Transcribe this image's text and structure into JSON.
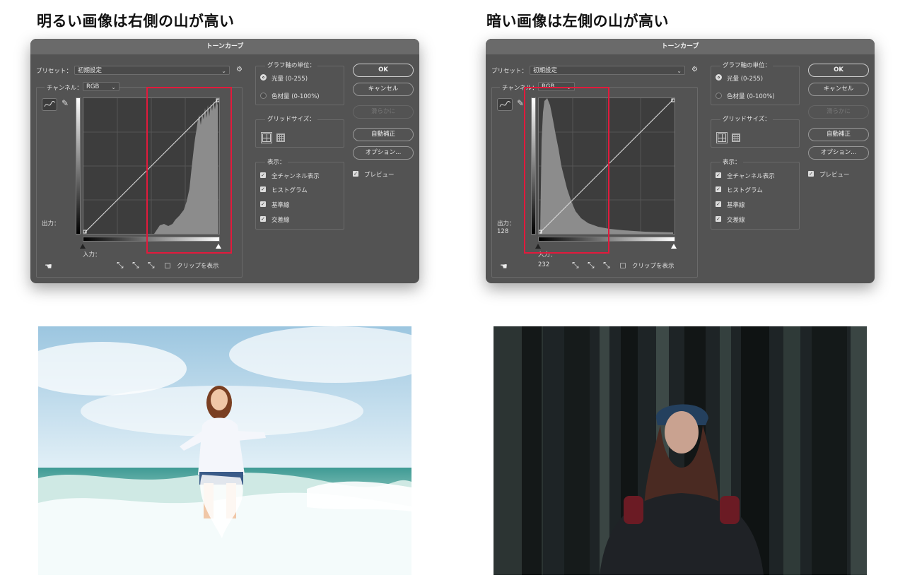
{
  "headings": {
    "bright": "明るい画像は右側の山が高い",
    "dark": "暗い画像は左側の山が高い"
  },
  "dialog": {
    "title": "トーンカーブ",
    "preset_label": "プリセット：",
    "preset_value": "初期設定",
    "channel_label": "チャンネル：",
    "channel_value": "RGB",
    "output_label": "出力：",
    "input_label": "入力：",
    "clip_label": "クリップを表示",
    "graph_unit_title": "グラフ軸の単位：",
    "radio_light": "光量 (0-255)",
    "radio_pigment": "色材量 (0-100%)",
    "grid_size_title": "グリッドサイズ：",
    "display_title": "表示：",
    "show_options": [
      "全チャンネル表示",
      "ヒストグラム",
      "基準線",
      "交差線"
    ],
    "buttons": {
      "ok": "OK",
      "cancel": "キャンセル",
      "smooth": "滑らかに",
      "auto": "自動補正",
      "options": "オプション..."
    },
    "preview_label": "プレビュー"
  },
  "left_dialog": {
    "output_value": "",
    "input_value": ""
  },
  "right_dialog": {
    "output_value": "128",
    "input_value": "232"
  },
  "icons": {
    "curve_tool": "curve-tool-icon",
    "pencil": "pencil-icon",
    "gear": "gear-icon",
    "eyedropper": "eyedropper-icon",
    "target_adjust": "target-adjust-icon"
  },
  "colors": {
    "highlight_box": "#e21a3c",
    "dialog_bg": "#535353"
  }
}
